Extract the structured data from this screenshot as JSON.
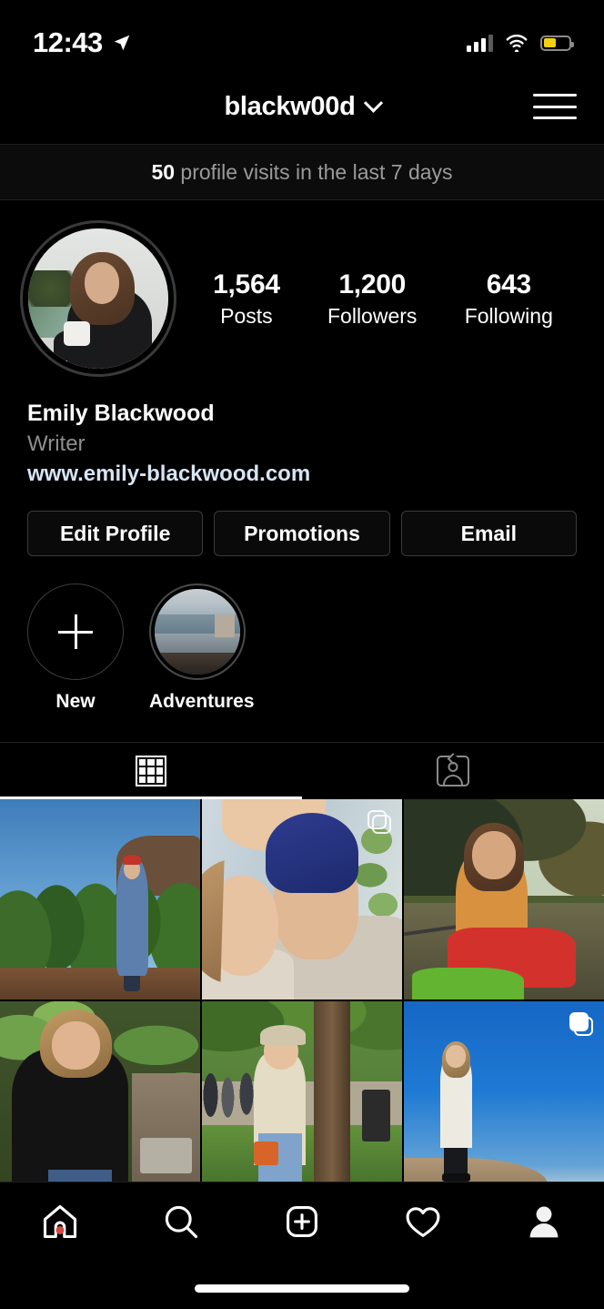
{
  "status_bar": {
    "time": "12:43",
    "location_icon": "location-arrow-icon",
    "signal_icon": "cellular-signal-icon",
    "signal_bars_filled": 3,
    "signal_bars_total": 4,
    "wifi_icon": "wifi-icon",
    "battery_icon": "battery-icon",
    "battery_level_percent": 50,
    "battery_color": "#f5cf12"
  },
  "nav": {
    "username": "blackw00d",
    "chevron_icon": "chevron-down-icon",
    "menu_icon": "hamburger-menu-icon"
  },
  "visits_banner": {
    "count": "50",
    "text": " profile visits in the last 7 days"
  },
  "profile": {
    "avatar_alt": "profile-photo",
    "stats": [
      {
        "value": "1,564",
        "label": "Posts"
      },
      {
        "value": "1,200",
        "label": "Followers"
      },
      {
        "value": "643",
        "label": "Following"
      }
    ],
    "full_name": "Emily Blackwood",
    "category": "Writer",
    "website": "www.emily-blackwood.com",
    "website_color": "#d7e4f4"
  },
  "actions": [
    {
      "label": "Edit Profile"
    },
    {
      "label": "Promotions"
    },
    {
      "label": "Email"
    }
  ],
  "highlights": [
    {
      "label": "New",
      "icon": "plus-icon"
    },
    {
      "label": "Adventures",
      "icon": "highlight-cover-harbor"
    }
  ],
  "tabs": [
    {
      "name": "grid",
      "icon": "grid-icon",
      "active": true
    },
    {
      "name": "tagged",
      "icon": "tagged-person-icon",
      "active": false
    }
  ],
  "grid_posts": [
    {
      "alt": "christmas-tree-farm-photo",
      "carousel": false
    },
    {
      "alt": "couple-selfie-photo",
      "carousel": true,
      "carousel_style": "outline"
    },
    {
      "alt": "kayaking-river-photo",
      "carousel": false
    },
    {
      "alt": "black-cardigan-tropical-photo",
      "carousel": false
    },
    {
      "alt": "park-orange-bag-photo",
      "carousel": false
    },
    {
      "alt": "mountain-summit-photo",
      "carousel": true,
      "carousel_style": "solid"
    }
  ],
  "bottom_nav": [
    {
      "name": "home",
      "icon": "home-icon",
      "active": false,
      "badge": true
    },
    {
      "name": "search",
      "icon": "search-icon",
      "active": false,
      "badge": false
    },
    {
      "name": "create",
      "icon": "add-post-icon",
      "active": false,
      "badge": false
    },
    {
      "name": "activity",
      "icon": "heart-icon",
      "active": false,
      "badge": false
    },
    {
      "name": "profile",
      "icon": "profile-avatar-icon",
      "active": true,
      "badge": false
    }
  ],
  "home_indicator": "home-indicator-bar"
}
